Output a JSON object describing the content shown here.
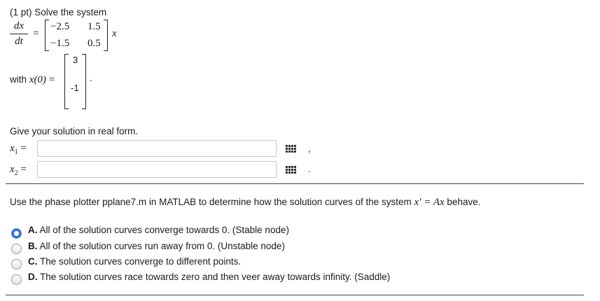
{
  "problem": {
    "points": "(1 pt)",
    "intro": "Solve the system",
    "lhs_num": "dx",
    "lhs_den": "dt",
    "equals": "=",
    "matrix": [
      [
        "−2.5",
        "1.5"
      ],
      [
        "−1.5",
        "0.5"
      ]
    ],
    "vec_var": "x",
    "ic_label": "with",
    "ic_var": "x(0)",
    "ic_vector": [
      "3",
      "-1"
    ],
    "period": "."
  },
  "instruction": "Give your solution in real form.",
  "answers": [
    {
      "var": "x",
      "sub": "1",
      "value": "",
      "trail": ","
    },
    {
      "var": "x",
      "sub": "2",
      "value": "",
      "trail": "."
    }
  ],
  "question": {
    "text_before": "Use the phase plotter pplane7.m in MATLAB to determine how the solution curves of the system ",
    "math": "x′ = Ax",
    "text_after": " behave."
  },
  "options": [
    {
      "letter": "A.",
      "text": "All of the solution curves converge towards 0. (Stable node)",
      "selected": true
    },
    {
      "letter": "B.",
      "text": "All of the solution curves run away from 0. (Unstable node)",
      "selected": false
    },
    {
      "letter": "C.",
      "text": "The solution curves converge to different points.",
      "selected": false
    },
    {
      "letter": "D.",
      "text": "The solution curves race towards zero and then veer away towards infinity. (Saddle)",
      "selected": false
    }
  ]
}
